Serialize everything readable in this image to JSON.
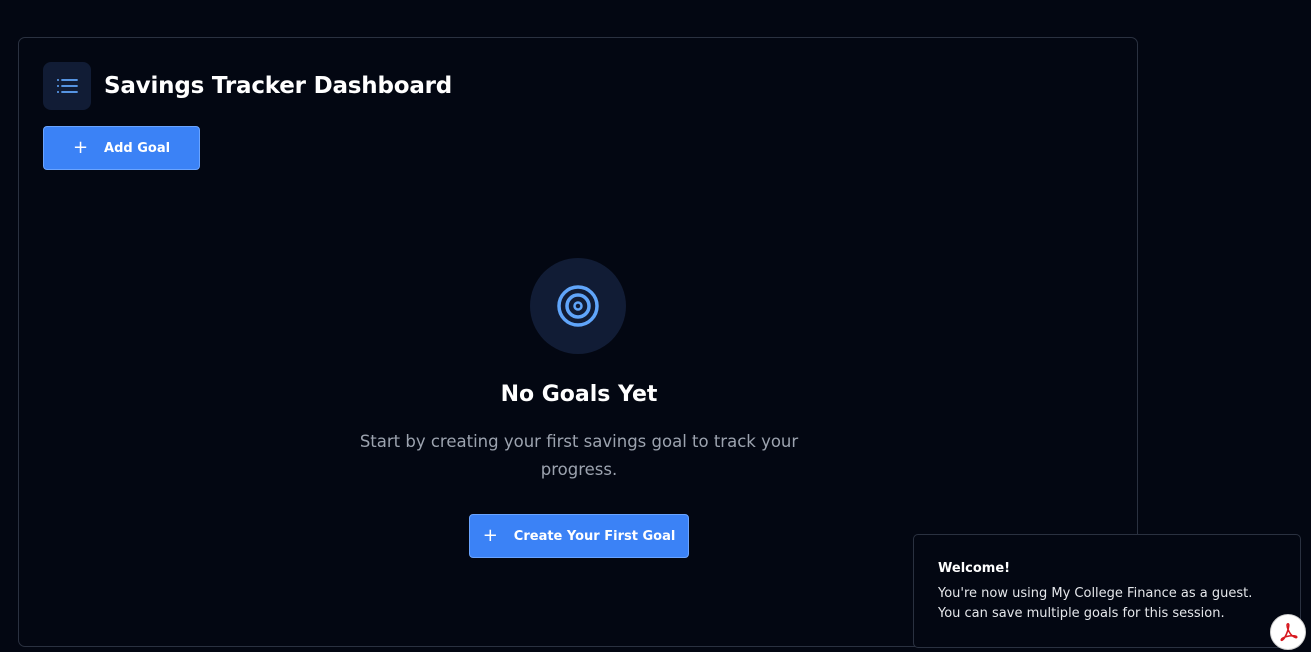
{
  "header": {
    "title": "Savings Tracker Dashboard",
    "icon": "list-icon"
  },
  "toolbar": {
    "add_goal_label": "Add Goal",
    "add_icon": "plus-icon"
  },
  "empty_state": {
    "icon": "target-icon",
    "title": "No Goals Yet",
    "description": "Start by creating your first savings goal to track your progress.",
    "cta_label": "Create Your First Goal"
  },
  "toast": {
    "title": "Welcome!",
    "message": "You're now using My College Finance as a guest. You can save multiple goals for this session."
  },
  "floating": {
    "icon": "pdf-icon"
  },
  "colors": {
    "background": "#030712",
    "accent": "#3b82f6",
    "icon_bg": "#111c35",
    "icon_fg": "#60a5fa",
    "muted_text": "#9ca3af",
    "border": "#2a3140",
    "pdf_red": "#d71920"
  }
}
